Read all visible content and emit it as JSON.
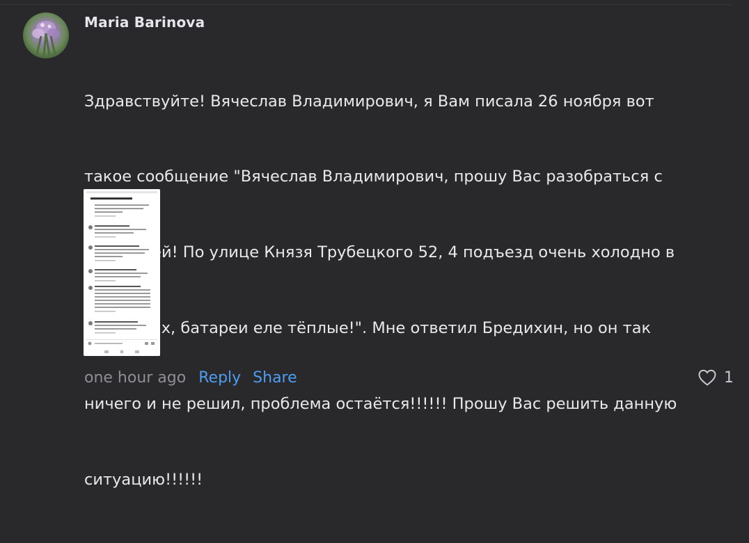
{
  "comment": {
    "author": "Maria Barinova",
    "text_lines": [
      "Здравствуйте! Вячеслав Владимирович, я Вам писала 26 ноября вот",
      "такое сообщение \"Вячеслав Владимирович, прошу Вас разобраться с",
      "ситуацией! По улице Князя Трубецкого 52, 4 подъезд очень холодно в",
      "квартирах, батареи еле тёплые!\". Мне ответил Бредихин, но он так",
      "ничего и не решил, проблема остаётся!!!!!! Прошу Вас решить данную",
      "ситуацию!!!!!!"
    ],
    "timestamp": "one hour ago",
    "reply_label": "Reply",
    "share_label": "Share",
    "like_count": "1",
    "icons": {
      "like": "heart-icon",
      "attachment": "screenshot-thumbnail"
    },
    "colors": {
      "background": "#29292b",
      "link": "#4d9df0",
      "muted": "#8e8e93"
    }
  }
}
